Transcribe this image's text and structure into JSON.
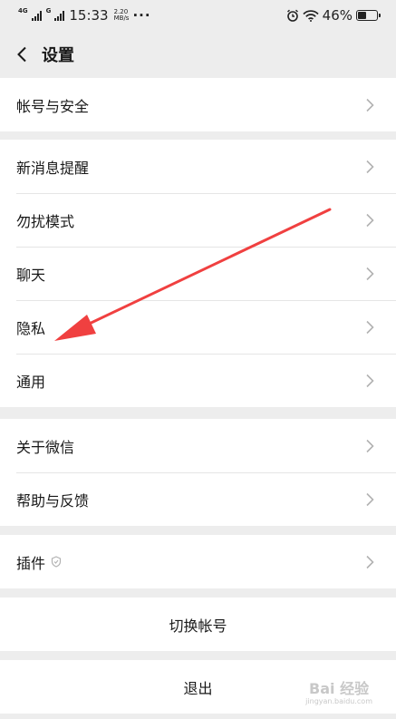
{
  "status_bar": {
    "network_label": "4G",
    "signal2_label": "G",
    "time": "15:33",
    "speed_value": "2.20",
    "speed_unit": "MB/s",
    "more_dots": "···",
    "battery_percent": "46%",
    "battery_level": 0.46
  },
  "header": {
    "title": "设置"
  },
  "groups": {
    "account": {
      "items": [
        {
          "label": "帐号与安全"
        }
      ]
    },
    "main": {
      "items": [
        {
          "label": "新消息提醒"
        },
        {
          "label": "勿扰模式"
        },
        {
          "label": "聊天"
        },
        {
          "label": "隐私"
        },
        {
          "label": "通用"
        }
      ]
    },
    "about": {
      "items": [
        {
          "label": "关于微信"
        },
        {
          "label": "帮助与反馈"
        }
      ]
    },
    "plugins": {
      "items": [
        {
          "label": "插件"
        }
      ]
    }
  },
  "actions": {
    "switch_account": "切换帐号",
    "logout": "退出"
  },
  "watermark": {
    "brand": "Bai 经验",
    "url": "jingyan.baidu.com"
  },
  "colors": {
    "background": "#ededed",
    "arrow": "#f04040"
  }
}
